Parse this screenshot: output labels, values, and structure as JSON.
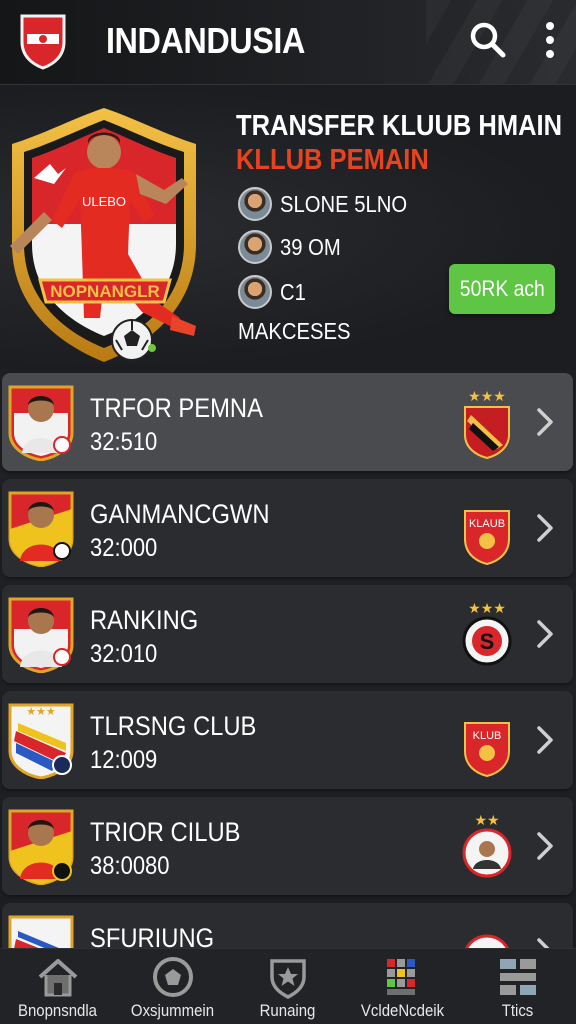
{
  "header": {
    "title": "INDANDUSIA"
  },
  "hero": {
    "heading": "TRANSFER KLUUB HMAIN",
    "subheading": "KLLUB PEMAIN",
    "crest_banner": "NOPNANGLR",
    "crest_jersey": "ULEBO",
    "stats": [
      {
        "label": "SLONE 5LNO"
      },
      {
        "label": "39 OM"
      },
      {
        "label": "C1"
      },
      {
        "label": "MAKCESES"
      }
    ],
    "action_label": "50RK ach"
  },
  "list": {
    "items": [
      {
        "name": "TRFOR PEMNA",
        "value": "32:510"
      },
      {
        "name": "GANMANCGWN",
        "value": "32:000"
      },
      {
        "name": "RANKING",
        "value": "32:010"
      },
      {
        "name": "TLRSNG CLUB",
        "value": "12:009"
      },
      {
        "name": "TRIOR CILUB",
        "value": "38:0080"
      },
      {
        "name": "SFURIUNG",
        "value": ""
      }
    ],
    "club_texts": [
      "KLAUB",
      "KLUB"
    ]
  },
  "nav": {
    "items": [
      {
        "label": "Bnopnsndla"
      },
      {
        "label": "Oxsjummein"
      },
      {
        "label": "Runaing"
      },
      {
        "label": "VcldeΝcdeik"
      },
      {
        "label": "Ttics"
      }
    ]
  },
  "colors": {
    "accent_red": "#e8431f",
    "button_green": "#5fc545",
    "crest_gold": "#e0a526",
    "background": "#1e1f22"
  }
}
